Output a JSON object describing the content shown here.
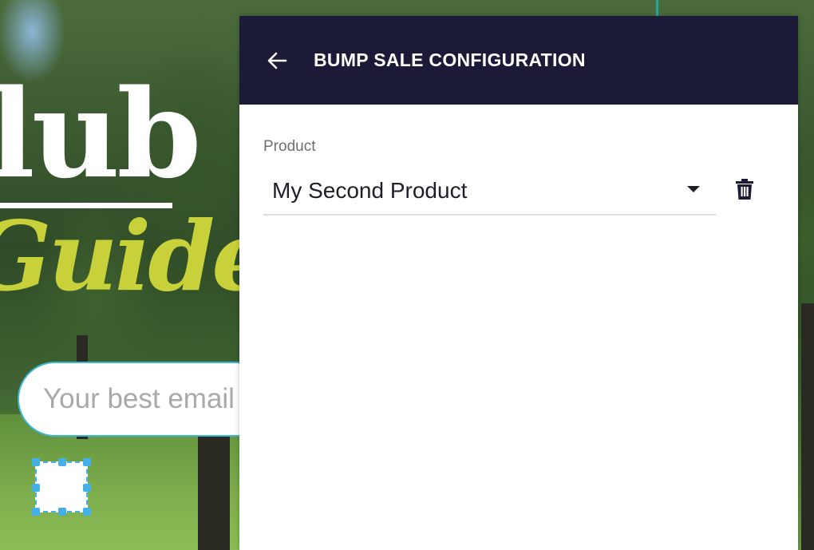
{
  "background": {
    "headline_fragment_1": "lub",
    "headline_fragment_2": "Guide",
    "email_placeholder": "Your best email"
  },
  "panel": {
    "title": "BUMP SALE CONFIGURATION",
    "back_icon": "arrow-left-icon",
    "product_label": "Product",
    "product_value": "My Second Product",
    "dropdown_icon": "caret-down-icon",
    "delete_icon": "trash-icon"
  },
  "colors": {
    "header_bg": "#1b1a37",
    "header_text": "#ffffff",
    "accent_input_border": "#3db7d8",
    "selection_handles": "#45b0e6",
    "headline_yellow": "#c8d13a"
  }
}
